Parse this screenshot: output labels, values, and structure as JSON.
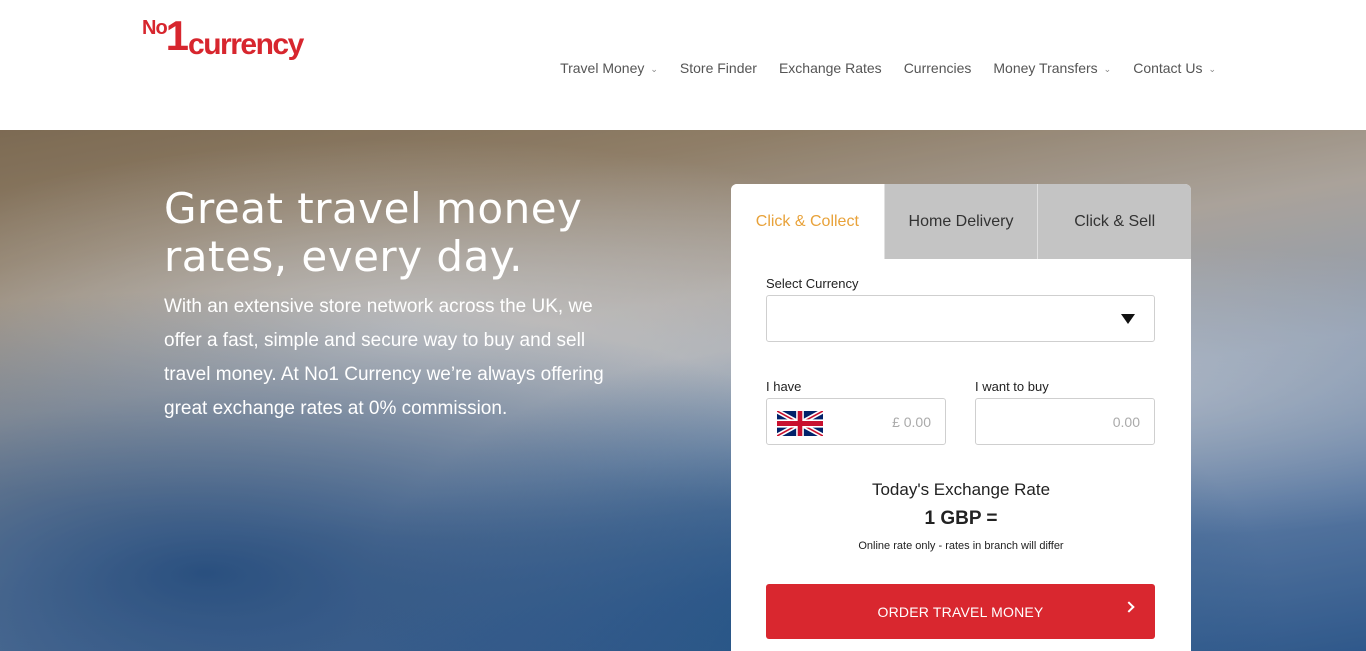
{
  "logo": {
    "no": "No",
    "one": "1",
    "word": "currency"
  },
  "nav": {
    "items": [
      {
        "label": "Travel Money",
        "has_dropdown": true
      },
      {
        "label": "Store Finder",
        "has_dropdown": false
      },
      {
        "label": "Exchange Rates",
        "has_dropdown": false
      },
      {
        "label": "Currencies",
        "has_dropdown": false
      },
      {
        "label": "Money Transfers",
        "has_dropdown": true
      },
      {
        "label": "Contact Us",
        "has_dropdown": true
      }
    ],
    "caret": "⌄"
  },
  "hero": {
    "title": "Great travel money rates, every day.",
    "text": "With an extensive store network across the UK, we offer a fast, simple and secure way to buy and sell travel money. At No1 Currency we’re always offering great exchange rates at 0% commission."
  },
  "widget": {
    "tabs": [
      {
        "label": "Click & Collect",
        "active": true
      },
      {
        "label": "Home Delivery",
        "active": false
      },
      {
        "label": "Click & Sell",
        "active": false
      }
    ],
    "select_label": "Select Currency",
    "select_value": "",
    "have_label": "I have",
    "have_placeholder": "£ 0.00",
    "have_flag_icon": "uk-flag-icon",
    "want_label": "I want to buy",
    "want_placeholder": "0.00",
    "rate_title": "Today's Exchange Rate",
    "rate_value": "1 GBP =",
    "rate_note": "Online rate only - rates in branch will differ",
    "order_button": "ORDER TRAVEL MONEY"
  },
  "colors": {
    "brand_red": "#d9272f",
    "active_tab": "#e8a23a",
    "inactive_tab": "#c4c4c4"
  }
}
